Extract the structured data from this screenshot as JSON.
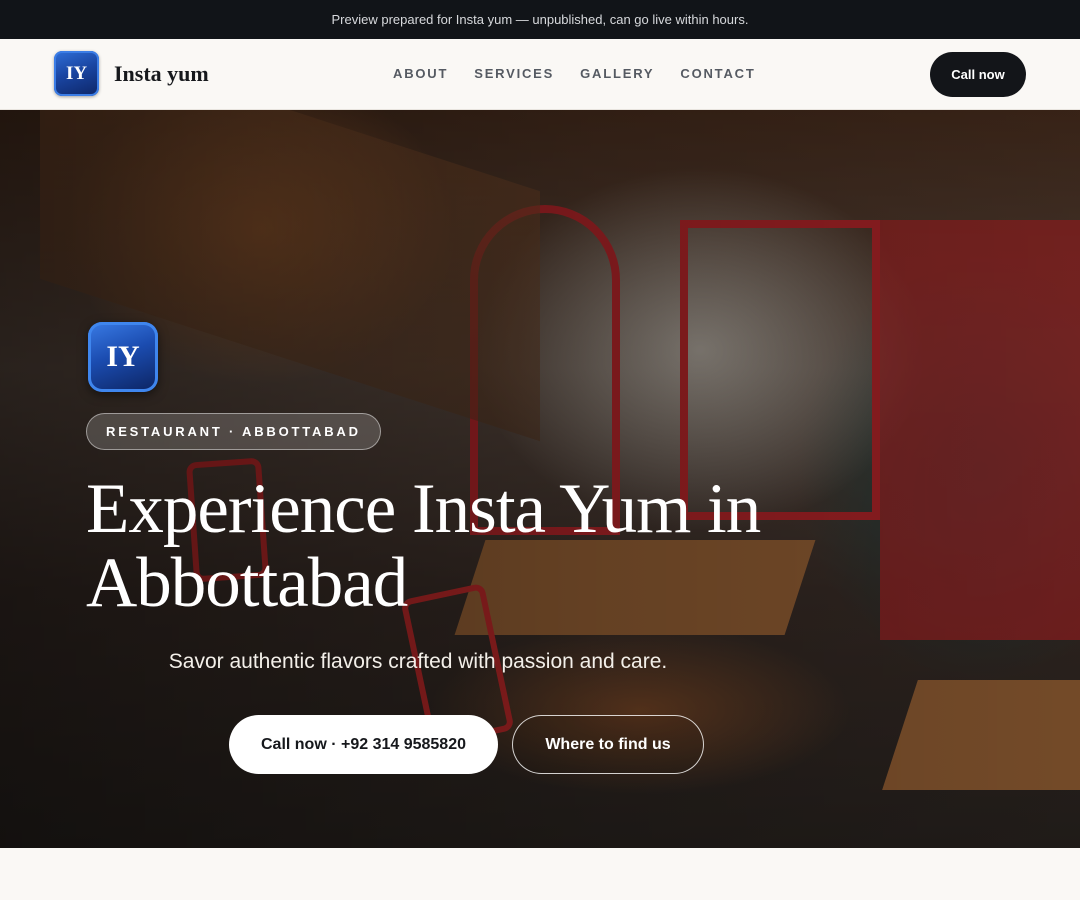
{
  "preview_bar": {
    "text": "Preview prepared for Insta yum — unpublished, can go live within hours."
  },
  "header": {
    "logo_text": "IY",
    "brand_name": "Insta yum",
    "nav": [
      "ABOUT",
      "SERVICES",
      "GALLERY",
      "CONTACT"
    ],
    "call_label": "Call now"
  },
  "hero": {
    "logo_text": "IY",
    "tagline": "RESTAURANT · ABBOTTABAD",
    "title": "Experience Insta Yum in Abbottabad",
    "subtitle": "Savor authentic flavors crafted with passion and care.",
    "primary_cta": "Call now · +92 314 9585820",
    "secondary_cta": "Where to find us",
    "background_image": "restaurant-interior"
  },
  "colors": {
    "dark": "#131519",
    "logo_blue": "#1a46a3",
    "page_bg": "#faf8f5"
  }
}
